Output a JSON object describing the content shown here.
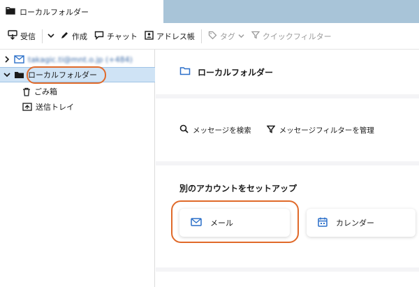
{
  "tab": {
    "title": "ローカルフォルダー",
    "icon": "folder-icon"
  },
  "toolbar": {
    "receive": "受信",
    "compose": "作成",
    "chat": "チャット",
    "address_book": "アドレス帳",
    "tag": "タグ",
    "quick_filter": "クイックフィルター"
  },
  "folders": {
    "account_label": "takagic.ti@mnt.o.jp (+484)",
    "local_folders": "ローカルフォルダー",
    "trash": "ごみ箱",
    "outbox": "送信トレイ"
  },
  "content": {
    "header_title": "ローカルフォルダー",
    "search_messages": "メッセージを検索",
    "manage_filters": "メッセージフィルターを管理",
    "setup_title": "別のアカウントをセットアップ",
    "mail_card": "メール",
    "calendar_card": "カレンダー"
  },
  "colors": {
    "titlebar": "#a8c4d8",
    "selected_row": "#cfe3f5",
    "highlight": "#e06a2a",
    "accent_blue": "#2a6fc9"
  }
}
